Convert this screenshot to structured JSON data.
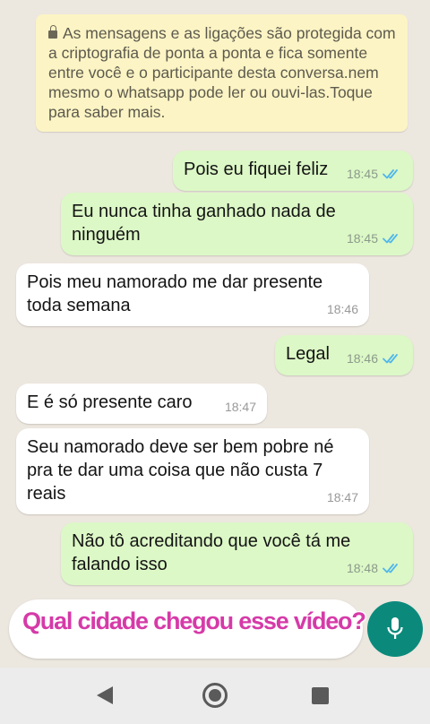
{
  "notice": {
    "text": "As mensagens e as ligações são protegida com a criptografia de ponta a ponta e fica somente entre você e o participante desta conversa.nem mesmo o whatsapp pode ler ou ouvi-las.Toque para saber mais."
  },
  "messages": [
    {
      "direction": "out",
      "text": "Pois eu fiquei feliz",
      "time": "18:45",
      "status": "read"
    },
    {
      "direction": "out",
      "text": "Eu nunca tinha ganhado nada de ninguém",
      "time": "18:45",
      "status": "read"
    },
    {
      "direction": "in",
      "text": "Pois meu namorado me dar presente toda semana",
      "time": "18:46"
    },
    {
      "direction": "out",
      "text": "Legal",
      "time": "18:46",
      "status": "read"
    },
    {
      "direction": "in",
      "text": "E é só presente caro",
      "time": "18:47"
    },
    {
      "direction": "in",
      "text": "Seu namorado deve ser bem pobre né pra te dar uma coisa que não custa 7 reais",
      "time": "18:47"
    },
    {
      "direction": "out",
      "text": "Não tô acreditando que você tá me falando isso",
      "time": "18:48",
      "status": "read"
    }
  ],
  "composer": {
    "caption": "Qual cidade chegou esse vídeo?"
  },
  "icons": {
    "mic": "microphone-icon",
    "read_ticks": "double-check-icon",
    "lock": "lock-icon"
  },
  "colors": {
    "outgoing_bubble": "#dcf8c6",
    "incoming_bubble": "#ffffff",
    "notice_bg": "#fcf4c4",
    "read_ticks": "#4fb6ec",
    "mic_button": "#0b8a7c",
    "caption": "#d63aa8"
  }
}
